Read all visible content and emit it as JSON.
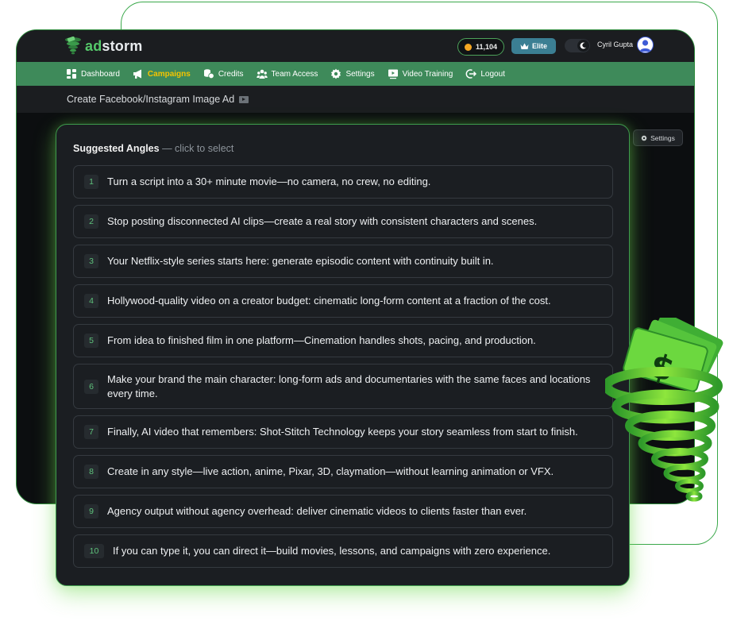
{
  "brand": {
    "name_prefix": "ad",
    "name_suffix": "storm",
    "accent": "#55c96a"
  },
  "header": {
    "credits": "11,104",
    "plan_label": "Elite",
    "user_name": "Cyril Gupta",
    "icons": [
      "coin-icon",
      "crown-icon",
      "moon-icon",
      "avatar"
    ]
  },
  "nav": {
    "items": [
      {
        "label": "Dashboard",
        "icon": "dashboard-icon",
        "active": false
      },
      {
        "label": "Campaigns",
        "icon": "megaphone-icon",
        "active": true
      },
      {
        "label": "Credits",
        "icon": "coins-icon",
        "active": false
      },
      {
        "label": "Team Access",
        "icon": "team-icon",
        "active": false
      },
      {
        "label": "Settings",
        "icon": "gear-icon",
        "active": false
      },
      {
        "label": "Video Training",
        "icon": "video-icon",
        "active": false
      },
      {
        "label": "Logout",
        "icon": "logout-icon",
        "active": false
      }
    ],
    "bar_color": "#3e8a5a",
    "active_color": "#f5c400"
  },
  "page": {
    "title": "Create Facebook/Instagram Image Ad"
  },
  "settings_button": {
    "label": "Settings"
  },
  "angles": {
    "heading": "Suggested Angles",
    "hint": " — click to select",
    "items": [
      {
        "num": "1",
        "text": "Turn a script into a 30+ minute movie—no camera, no crew, no editing."
      },
      {
        "num": "2",
        "text": "Stop posting disconnected AI clips—create a real story with consistent characters and scenes."
      },
      {
        "num": "3",
        "text": "Your Netflix-style series starts here: generate episodic content with continuity built in."
      },
      {
        "num": "4",
        "text": "Hollywood-quality video on a creator budget: cinematic long-form content at a fraction of the cost."
      },
      {
        "num": "5",
        "text": "From idea to finished film in one platform—Cinemation handles shots, pacing, and production."
      },
      {
        "num": "6",
        "text": "Make your brand the main character: long-form ads and documentaries with the same faces and locations every time."
      },
      {
        "num": "7",
        "text": "Finally, AI video that remembers: Shot-Stitch Technology keeps your story seamless from start to finish."
      },
      {
        "num": "8",
        "text": "Create in any style—live action, anime, Pixar, 3D, claymation—without learning animation or VFX."
      },
      {
        "num": "9",
        "text": "Agency output without agency overhead: deliver cinematic videos to clients faster than ever."
      },
      {
        "num": "10",
        "text": "If you can type it, you can direct it—build movies, lessons, and campaigns with zero experience."
      }
    ]
  },
  "decoration": {
    "mascot": "money-tornado-illustration"
  }
}
